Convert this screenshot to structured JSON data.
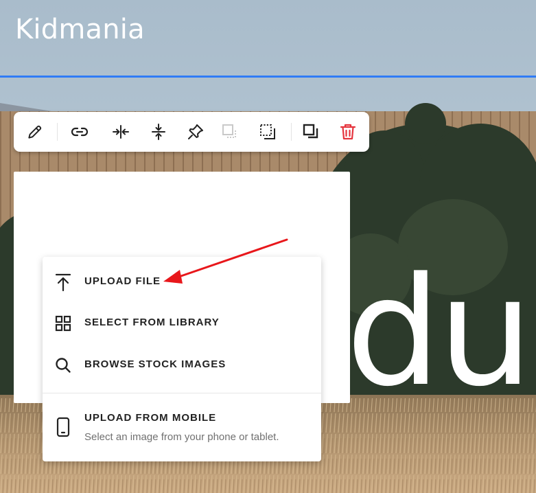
{
  "site": {
    "title": "Kidmania"
  },
  "hero": {
    "text": "duc"
  },
  "toolbar": {
    "buttons": [
      {
        "icon": "pencil-icon"
      },
      {
        "icon": "link-icon"
      },
      {
        "icon": "shrink-horizontal-icon"
      },
      {
        "icon": "shrink-vertical-icon"
      },
      {
        "icon": "pin-icon"
      },
      {
        "icon": "crop-disabled-icon"
      },
      {
        "icon": "crop-icon"
      },
      {
        "icon": "duplicate-icon"
      },
      {
        "icon": "trash-icon"
      }
    ],
    "delete_color": "#e5343d",
    "disabled_color": "#c9c9c9"
  },
  "upload_menu": {
    "items": [
      {
        "label": "UPLOAD FILE",
        "icon": "upload-icon"
      },
      {
        "label": "SELECT FROM LIBRARY",
        "icon": "grid-icon"
      },
      {
        "label": "BROWSE STOCK IMAGES",
        "icon": "search-icon"
      },
      {
        "label": "UPLOAD FROM MOBILE",
        "sublabel": "Select an image from your phone or tablet.",
        "icon": "phone-icon"
      }
    ]
  },
  "colors": {
    "accent_line": "#2f7cf6",
    "annotation_arrow": "#e8171b"
  }
}
